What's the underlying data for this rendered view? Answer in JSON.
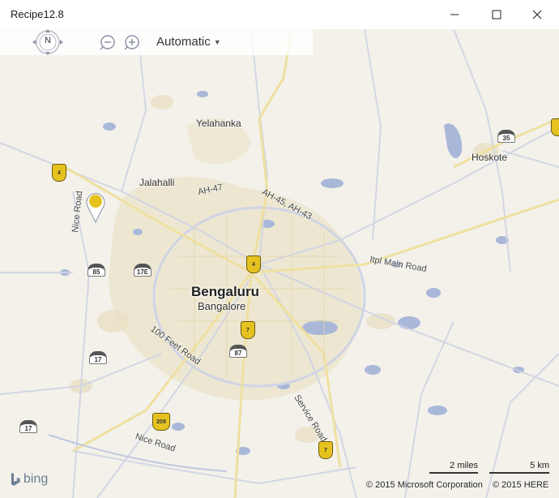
{
  "window": {
    "title": "Recipe12.8"
  },
  "toolbar": {
    "heading": "N",
    "mode": "Automatic",
    "icons": [
      "compass-icon",
      "zoom-out-icon",
      "zoom-in-icon",
      "dropdown-caret-icon"
    ]
  },
  "map": {
    "labels": {
      "city": "Bengaluru",
      "city_alt": "Bangalore",
      "yelahanka": "Yelahanka",
      "jalahalli": "Jalahalli",
      "hoskote": "Hoskote"
    },
    "roads": {
      "ah47": "AH-47",
      "ah45_43": "AH-45, AH-43",
      "itpl": "Itpl Main Road",
      "foot100": "100 Feet Road",
      "nice1": "Nice Road",
      "nice2": "Nice Road",
      "service": "Service Road"
    },
    "shields_yellow": [
      "4",
      "4",
      "7",
      "209",
      "7"
    ],
    "shields_national": [
      "35",
      "85",
      "17E",
      "17",
      "87",
      "17"
    ]
  },
  "footer": {
    "logo": "bing",
    "scale_miles": "2 miles",
    "scale_km": "5 km",
    "copyright_ms": "© 2015 Microsoft Corporation",
    "copyright_here": "© 2015 HERE"
  },
  "colors": {
    "map_bg": "#f3f1ea",
    "urban": "#ece6cf",
    "water": "#a9b7d8",
    "major_road": "#f0e3a4",
    "minor_road": "#ccd1e3",
    "shield_yellow": "#e6c21f",
    "pin": "#e6c21f"
  }
}
